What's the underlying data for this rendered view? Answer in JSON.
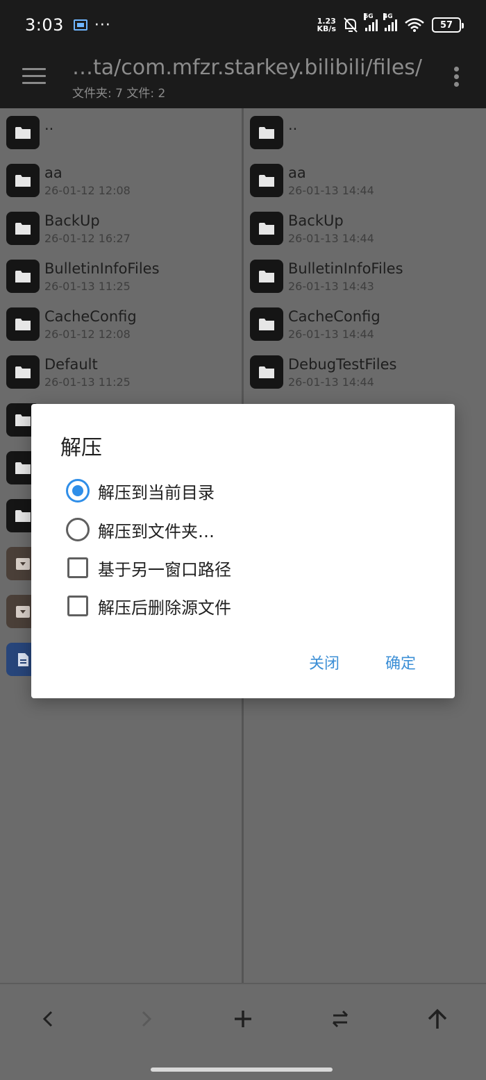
{
  "status_bar": {
    "time": "3:03",
    "dots": "···",
    "net_speed_value": "1.23",
    "net_speed_unit": "KB/s",
    "signal_1_tag": "5G",
    "signal_2_tag": "4G",
    "battery": "57"
  },
  "toolbar": {
    "path": "…ta/com.mfzr.starkey.bilibili/files/",
    "summary": "文件夹: 7  文件: 2"
  },
  "left_pane": {
    "items": [
      {
        "name": "..",
        "date": ""
      },
      {
        "name": "aa",
        "date": "26-01-12 12:08"
      },
      {
        "name": "BackUp",
        "date": "26-01-12 16:27"
      },
      {
        "name": "BulletinInfoFiles",
        "date": "26-01-13 11:25"
      },
      {
        "name": "CacheConfig",
        "date": "26-01-12 12:08"
      },
      {
        "name": "Default",
        "date": "26-01-13 11:25"
      }
    ]
  },
  "right_pane": {
    "items": [
      {
        "name": "..",
        "date": ""
      },
      {
        "name": "aa",
        "date": "26-01-13 14:44"
      },
      {
        "name": "BackUp",
        "date": "26-01-13 14:44"
      },
      {
        "name": "BulletinInfoFiles",
        "date": "26-01-13 14:43"
      },
      {
        "name": "CacheConfig",
        "date": "26-01-13 14:44"
      },
      {
        "name": "DebugTestFiles",
        "date": "26-01-13 14:44"
      }
    ]
  },
  "dialog": {
    "title": "解压",
    "option_current_dir": "解压到当前目录",
    "option_to_folder": "解压到文件夹…",
    "check_other_window": "基于另一窗口路径",
    "check_delete_source": "解压后删除源文件",
    "close_label": "关闭",
    "confirm_label": "确定"
  },
  "colors": {
    "accent": "#2f8ee8",
    "dialog_button": "#3c8fd6",
    "toolbar_bg": "#1b1b1b",
    "scrim_bg": "#6b6b6b"
  }
}
